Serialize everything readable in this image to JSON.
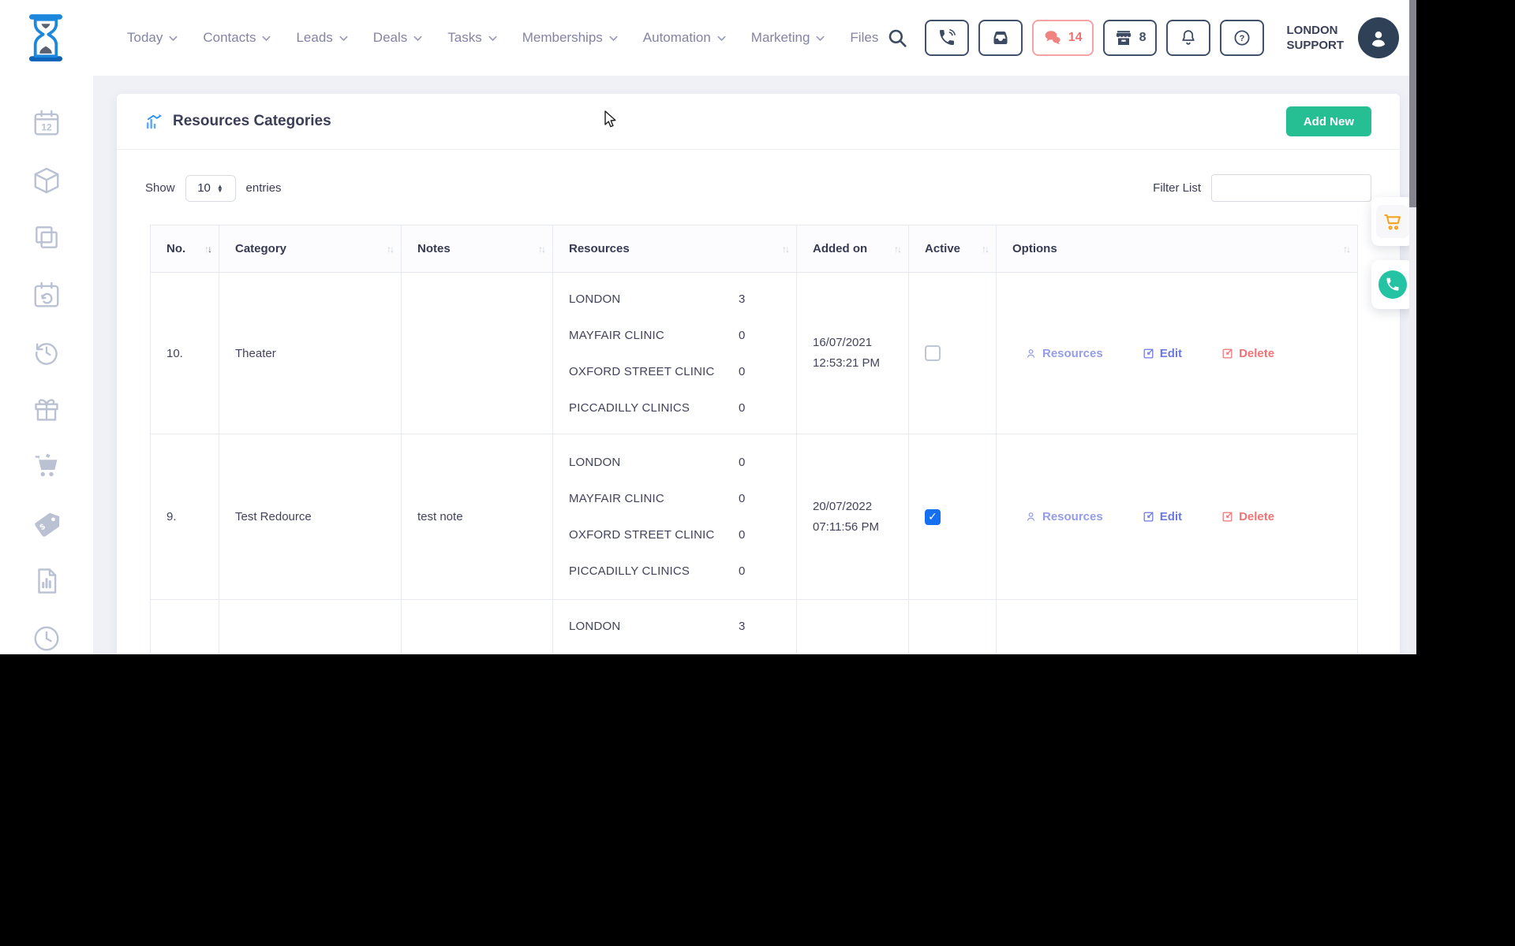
{
  "navbar": {
    "menu": [
      {
        "label": "Today",
        "caret": true
      },
      {
        "label": "Contacts",
        "caret": true
      },
      {
        "label": "Leads",
        "caret": true
      },
      {
        "label": "Deals",
        "caret": true
      },
      {
        "label": "Tasks",
        "caret": true
      },
      {
        "label": "Memberships",
        "caret": true
      },
      {
        "label": "Automation",
        "caret": true
      },
      {
        "label": "Marketing",
        "caret": true
      },
      {
        "label": "Files",
        "caret": false
      }
    ],
    "chat_badge": "14",
    "store_badge": "8",
    "user_name_line1": "LONDON",
    "user_name_line2": "SUPPORT"
  },
  "sidebar": {
    "icons": [
      "calendar-icon",
      "package-icon",
      "copy-icon",
      "calendar-sync-icon",
      "history-icon",
      "gift-icon",
      "cart-icon",
      "tag-icon",
      "report-icon",
      "clock-icon"
    ]
  },
  "page": {
    "title": "Resources Categories",
    "add_new_label": "Add New",
    "show_label": "Show",
    "page_size": "10",
    "entries_label": "entries",
    "filter_label": "Filter List",
    "filter_value": ""
  },
  "table": {
    "columns": [
      {
        "label": "No.",
        "sorted": true
      },
      {
        "label": "Category",
        "sorted": false
      },
      {
        "label": "Notes",
        "sorted": false
      },
      {
        "label": "Resources",
        "sorted": false
      },
      {
        "label": "Added on",
        "sorted": false
      },
      {
        "label": "Active",
        "sorted": false
      },
      {
        "label": "Options",
        "sorted": false
      }
    ],
    "rows": [
      {
        "no": "10.",
        "category": "Theater",
        "notes": "",
        "resources": [
          {
            "name": "LONDON",
            "count": "3"
          },
          {
            "name": "MAYFAIR CLINIC",
            "count": "0"
          },
          {
            "name": "OXFORD STREET CLINIC",
            "count": "0"
          },
          {
            "name": "PICCADILLY CLINICS",
            "count": "0"
          }
        ],
        "added_date": "16/07/2021",
        "added_time": "12:53:21 PM",
        "active": false,
        "partial": false,
        "options": {
          "resources": "Resources",
          "edit": "Edit",
          "delete": "Delete"
        }
      },
      {
        "no": "9.",
        "category": "Test Redource",
        "notes": "test note",
        "resources": [
          {
            "name": "LONDON",
            "count": "0"
          },
          {
            "name": "MAYFAIR CLINIC",
            "count": "0"
          },
          {
            "name": "OXFORD STREET CLINIC",
            "count": "0"
          },
          {
            "name": "PICCADILLY CLINICS",
            "count": "0"
          }
        ],
        "added_date": "20/07/2022",
        "added_time": "07:11:56 PM",
        "active": true,
        "partial": false,
        "options": {
          "resources": "Resources",
          "edit": "Edit",
          "delete": "Delete"
        }
      },
      {
        "no": "",
        "category": "",
        "notes": "",
        "resources": [
          {
            "name": "LONDON",
            "count": "3"
          }
        ],
        "added_date": "",
        "added_time": "",
        "active": null,
        "partial": true,
        "options": null
      }
    ]
  },
  "colors": {
    "accent_teal": "#26bf94",
    "salmon": "#f0827f",
    "navy": "#3d4a63",
    "link_indigo": "#6d78e0",
    "link_light_indigo": "#959ce8",
    "link_red": "#ef7476",
    "checkbox_blue": "#1470f0",
    "logo_blue": "#1d86dd"
  }
}
